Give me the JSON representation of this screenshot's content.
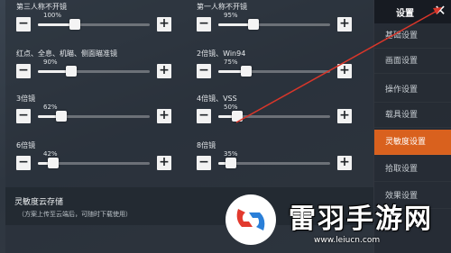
{
  "sidebar": {
    "title": "设置",
    "items": [
      {
        "label": "基础设置",
        "active": false
      },
      {
        "label": "画面设置",
        "active": false
      },
      {
        "label": "操作设置",
        "active": false
      },
      {
        "label": "载具设置",
        "active": false
      },
      {
        "label": "灵敏度设置",
        "active": true
      },
      {
        "label": "拾取设置",
        "active": false
      },
      {
        "label": "效果设置",
        "active": false
      }
    ],
    "accent_color": "#d9611e"
  },
  "sliders": [
    {
      "title": "第三人称不开镜",
      "value_text": "100%",
      "value": 100
    },
    {
      "title": "第一人称不开镜",
      "value_text": "95%",
      "value": 95
    },
    {
      "title": "红点、全息、机瞄、侧面瞄准镜",
      "value_text": "90%",
      "value": 90
    },
    {
      "title": "2倍镜、Win94",
      "value_text": "75%",
      "value": 75
    },
    {
      "title": "3倍镜",
      "value_text": "62%",
      "value": 62
    },
    {
      "title": "4倍镜、VSS",
      "value_text": "50%",
      "value": 50
    },
    {
      "title": "6倍镜",
      "value_text": "42%",
      "value": 42
    },
    {
      "title": "8倍镜",
      "value_text": "35%",
      "value": 35
    }
  ],
  "slider_min": 0,
  "slider_max": 300,
  "cloud": {
    "title": "灵敏度云存储",
    "subtitle": "（方案上传至云端后，可随时下载使用）"
  },
  "buttons": {
    "minus": "−",
    "plus": "+",
    "close": "✕"
  },
  "watermark": {
    "brand": "雷羽手游网",
    "url": "www.leiucn.com"
  }
}
